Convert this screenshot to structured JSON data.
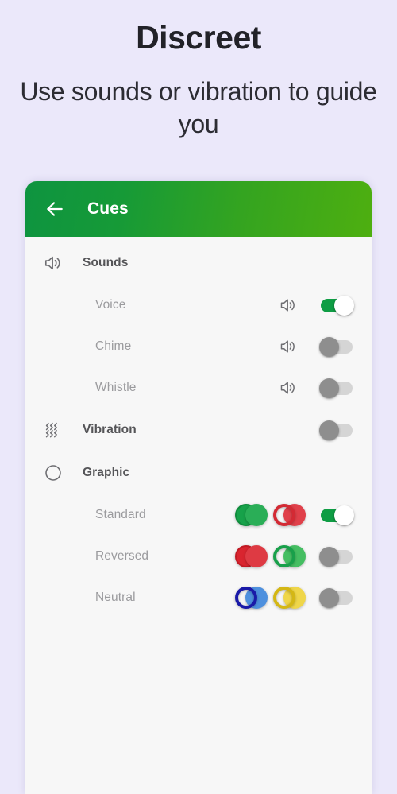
{
  "promo": {
    "title": "Discreet",
    "subtitle": "Use sounds or vibration to guide you"
  },
  "colors": {
    "page_background": "#EBE8FA",
    "card_background": "#F7F7F7",
    "appbar_gradient_start": "#0E9440",
    "appbar_gradient_end": "#4EAF10",
    "toggle_on_track": "#0F9D44",
    "toggle_off_thumb": "#8E8E8E",
    "toggle_off_track": "#D5D5D5",
    "heading_text": "#555558",
    "subitem_text": "#9B9B9E",
    "icon_stroke": "#6E6E72"
  },
  "appbar": {
    "back_icon": "arrow-left-icon",
    "title": "Cues"
  },
  "sections": [
    {
      "id": "sounds",
      "icon": "speaker-icon",
      "label": "Sounds",
      "has_toggle": false,
      "items": [
        {
          "id": "voice",
          "label": "Voice",
          "trailing_icon": "speaker-icon",
          "toggle": "on"
        },
        {
          "id": "chime",
          "label": "Chime",
          "trailing_icon": "speaker-icon",
          "toggle": "off"
        },
        {
          "id": "whistle",
          "label": "Whistle",
          "trailing_icon": "speaker-icon",
          "toggle": "off"
        }
      ]
    },
    {
      "id": "vibration",
      "icon": "vibration-waves-icon",
      "label": "Vibration",
      "has_toggle": true,
      "toggle": "off",
      "items": []
    },
    {
      "id": "graphic",
      "icon": "circle-outline-icon",
      "label": "Graphic",
      "has_toggle": false,
      "items": [
        {
          "id": "standard",
          "label": "Standard",
          "toggle": "on",
          "preview": [
            {
              "left": {
                "style": "solid",
                "color": "#17A24A"
              },
              "right": {
                "style": "solid",
                "color": "#17A24A"
              }
            },
            {
              "left": {
                "style": "ring",
                "color": "#D32A34"
              },
              "right": {
                "style": "solid",
                "color": "#E0404A"
              }
            }
          ]
        },
        {
          "id": "reversed",
          "label": "Reversed",
          "toggle": "off",
          "preview": [
            {
              "left": {
                "style": "solid",
                "color": "#D9252F"
              },
              "right": {
                "style": "solid",
                "color": "#D9252F"
              }
            },
            {
              "left": {
                "style": "ring",
                "color": "#18A04A"
              },
              "right": {
                "style": "solid",
                "color": "#45BE62"
              }
            }
          ]
        },
        {
          "id": "neutral",
          "label": "Neutral",
          "toggle": "off",
          "preview": [
            {
              "left": {
                "style": "ring",
                "color": "#1A1AA8"
              },
              "right": {
                "style": "solid",
                "color": "#4E90DE"
              }
            },
            {
              "left": {
                "style": "ring",
                "color": "#D4B715"
              },
              "right": {
                "style": "solid",
                "color": "#EFD64A"
              }
            }
          ]
        }
      ]
    }
  ]
}
